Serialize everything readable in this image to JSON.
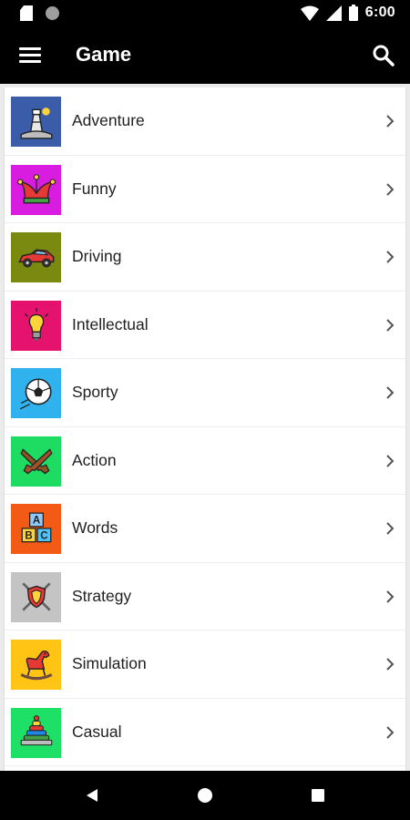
{
  "status_bar": {
    "time": "6:00",
    "left_icons": [
      "sd-card-icon",
      "notification-dot-icon"
    ],
    "right_icons": [
      "wifi-icon",
      "cell-signal-icon",
      "battery-icon"
    ]
  },
  "app_bar": {
    "title": "Game",
    "menu_icon": "menu-icon",
    "search_icon": "search-icon"
  },
  "categories": [
    {
      "label": "Adventure",
      "color": "#3b5ca8",
      "icon": "lighthouse-icon"
    },
    {
      "label": "Funny",
      "color": "#d81ce0",
      "icon": "jester-hat-icon"
    },
    {
      "label": "Driving",
      "color": "#7a8a10",
      "icon": "race-car-icon"
    },
    {
      "label": "Intellectual",
      "color": "#e6136e",
      "icon": "lightbulb-icon"
    },
    {
      "label": "Sporty",
      "color": "#30b2ee",
      "icon": "soccer-ball-icon"
    },
    {
      "label": "Action",
      "color": "#1edb62",
      "icon": "crossed-pistols-icon"
    },
    {
      "label": "Words",
      "color": "#f25a16",
      "icon": "abc-blocks-icon"
    },
    {
      "label": "Strategy",
      "color": "#c4c4c4",
      "icon": "crossed-swords-shield-icon"
    },
    {
      "label": "Simulation",
      "color": "#ffc414",
      "icon": "rocking-horse-icon"
    },
    {
      "label": "Casual",
      "color": "#1ee066",
      "icon": "ring-stack-toy-icon"
    }
  ],
  "nav_bar": {
    "icons": [
      "back-icon",
      "home-icon",
      "recent-apps-icon"
    ]
  }
}
